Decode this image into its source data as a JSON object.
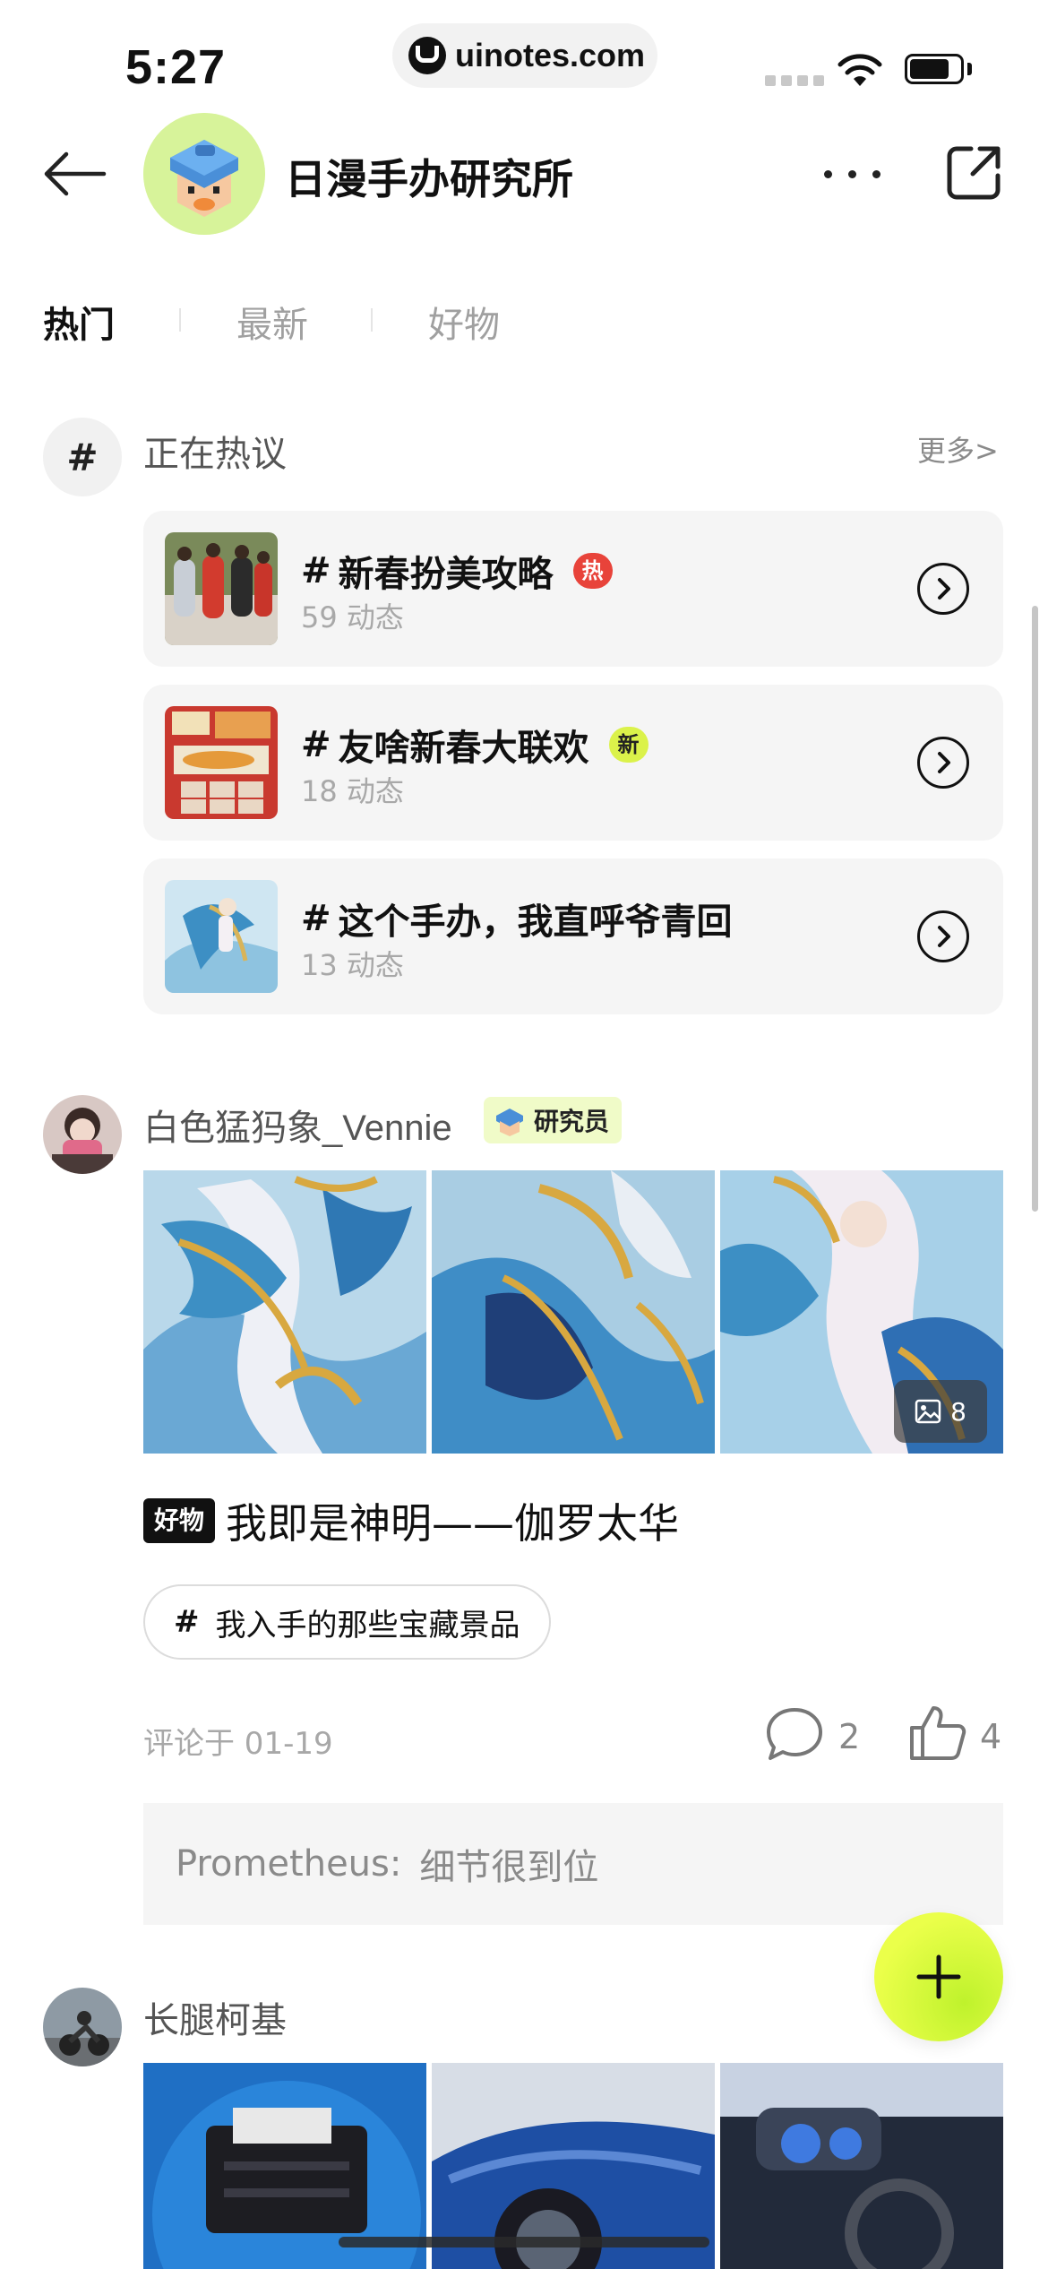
{
  "status_bar": {
    "time": "5:27",
    "url": "uinotes.com"
  },
  "header": {
    "title": "日漫手办研究所"
  },
  "tabs": [
    {
      "label": "热门",
      "active": true
    },
    {
      "label": "最新",
      "active": false
    },
    {
      "label": "好物",
      "active": false
    }
  ],
  "trending": {
    "icon_glyph": "#",
    "label": "正在热议",
    "more": "更多>",
    "topics": [
      {
        "prefix": "#",
        "title": "新春扮美攻略",
        "badge": "热",
        "count": "59 动态"
      },
      {
        "prefix": "#",
        "title": "友啥新春大联欢",
        "badge": "新",
        "count": "18 动态"
      },
      {
        "prefix": "#",
        "title": "这个手办，我直呼爷青回",
        "badge": "",
        "count": "13 动态"
      }
    ]
  },
  "posts": [
    {
      "author": "白色猛犸象_Vennie",
      "role": "研究员",
      "image_count": "8",
      "tag": "好物",
      "title": "我即是神明——伽罗太华",
      "topic_prefix": "#",
      "topic": "我入手的那些宝藏景品",
      "time": "评论于 01-19",
      "comments": "2",
      "likes": "4",
      "reply": {
        "name": "Prometheus:",
        "text": "细节很到位"
      }
    },
    {
      "author": "长腿柯基"
    }
  ],
  "colors": {
    "accent": "#dbf24a",
    "hot": "#e8433a",
    "fab": "#ccf536"
  }
}
